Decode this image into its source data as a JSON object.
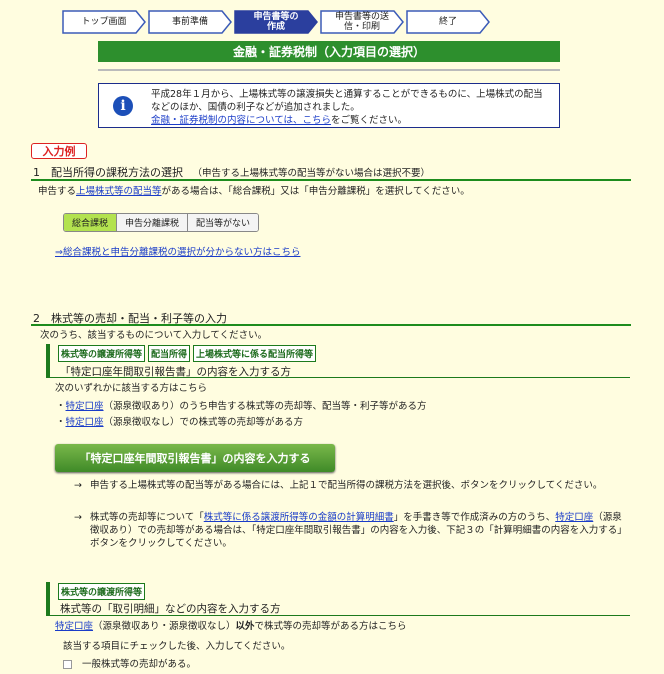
{
  "steps": [
    {
      "label": "トップ画面",
      "active": false
    },
    {
      "label": "事前準備",
      "active": false
    },
    {
      "label": "申告書等の作成",
      "active": true
    },
    {
      "label": "申告書等の送信・印刷",
      "active": false
    },
    {
      "label": "終了",
      "active": false
    }
  ],
  "page_title": "金融・証券税制（入力項目の選択）",
  "info": {
    "icon": "info-icon",
    "text1": "平成28年１月から、上場株式等の譲渡損失と通算することができるものに、上場株式の配当などのほか、国債の利子などが追加されました。",
    "link": "金融・証券税制の内容については、こちら",
    "text2": "をご覧ください。"
  },
  "example_label": "入力例",
  "section1": {
    "title": "1　配当所得の課税方法の選択",
    "subtitle": "（申告する上場株式等の配当等がない場合は選択不要）",
    "desc_pre": "申告する",
    "desc_link": "上場株式等の配当等",
    "desc_post": "がある場合は、「総合課税」又は「申告分離課税」を選択してください。",
    "options": [
      "総合課税",
      "申告分離課税",
      "配当等がない"
    ],
    "help_link": "⇒総合課税と申告分離課税の選択が分からない方はこちら"
  },
  "section2": {
    "title": "2　株式等の売却・配当・利子等の入力",
    "desc": "次のうち、該当するものについて入力してください。",
    "tags": [
      "株式等の譲渡所得等",
      "配当所得",
      "上場株式等に係る配当所得等"
    ],
    "block_title": "「特定口座年間取引報告書」の内容を入力する方",
    "applies": "次のいずれかに該当する方はこちら",
    "item1_link": "特定口座",
    "item1_text": "（源泉徴収あり）のうち申告する株式等の売却等、配当等・利子等がある方",
    "item2_link": "特定口座",
    "item2_text": "（源泉徴収なし）での株式等の売却等がある方",
    "button": "「特定口座年間取引報告書」の内容を入力する",
    "note1": "申告する上場株式等の配当等がある場合には、上記１で配当所得の課税方法を選択後、ボタンをクリックしてください。",
    "note2_a": "株式等の売却等について「",
    "note2_link1": "株式等に係る譲渡所得等の金額の計算明細書",
    "note2_b": "」を手書き等で作成済みの方のうち、",
    "note2_link2": "特定口座",
    "note2_c": "（源泉徴収あり）での売却等がある場合は、「特定口座年間取引報告書」の内容を入力後、下記３の「計算明細書の内容を入力する」ボタンをクリックしてください。",
    "arrow": "→",
    "tag2": "株式等の譲渡所得等",
    "block2_title": "株式等の「取引明細」などの内容を入力する方",
    "block2_link": "特定口座",
    "block2_text": "（源泉徴収あり・源泉徴収なし）",
    "block2_bold": "以外",
    "block2_text2": "で株式等の売却等がある方はこちら",
    "block2_desc": "該当する項目にチェックした後、入力してください。",
    "checkbox_label": "一般株式等の売却がある。"
  },
  "colors": {
    "accent_green": "#2d8f2d",
    "link": "#1a3cc8",
    "example_red": "#dd2222",
    "step_active": "#2b3f9e"
  }
}
